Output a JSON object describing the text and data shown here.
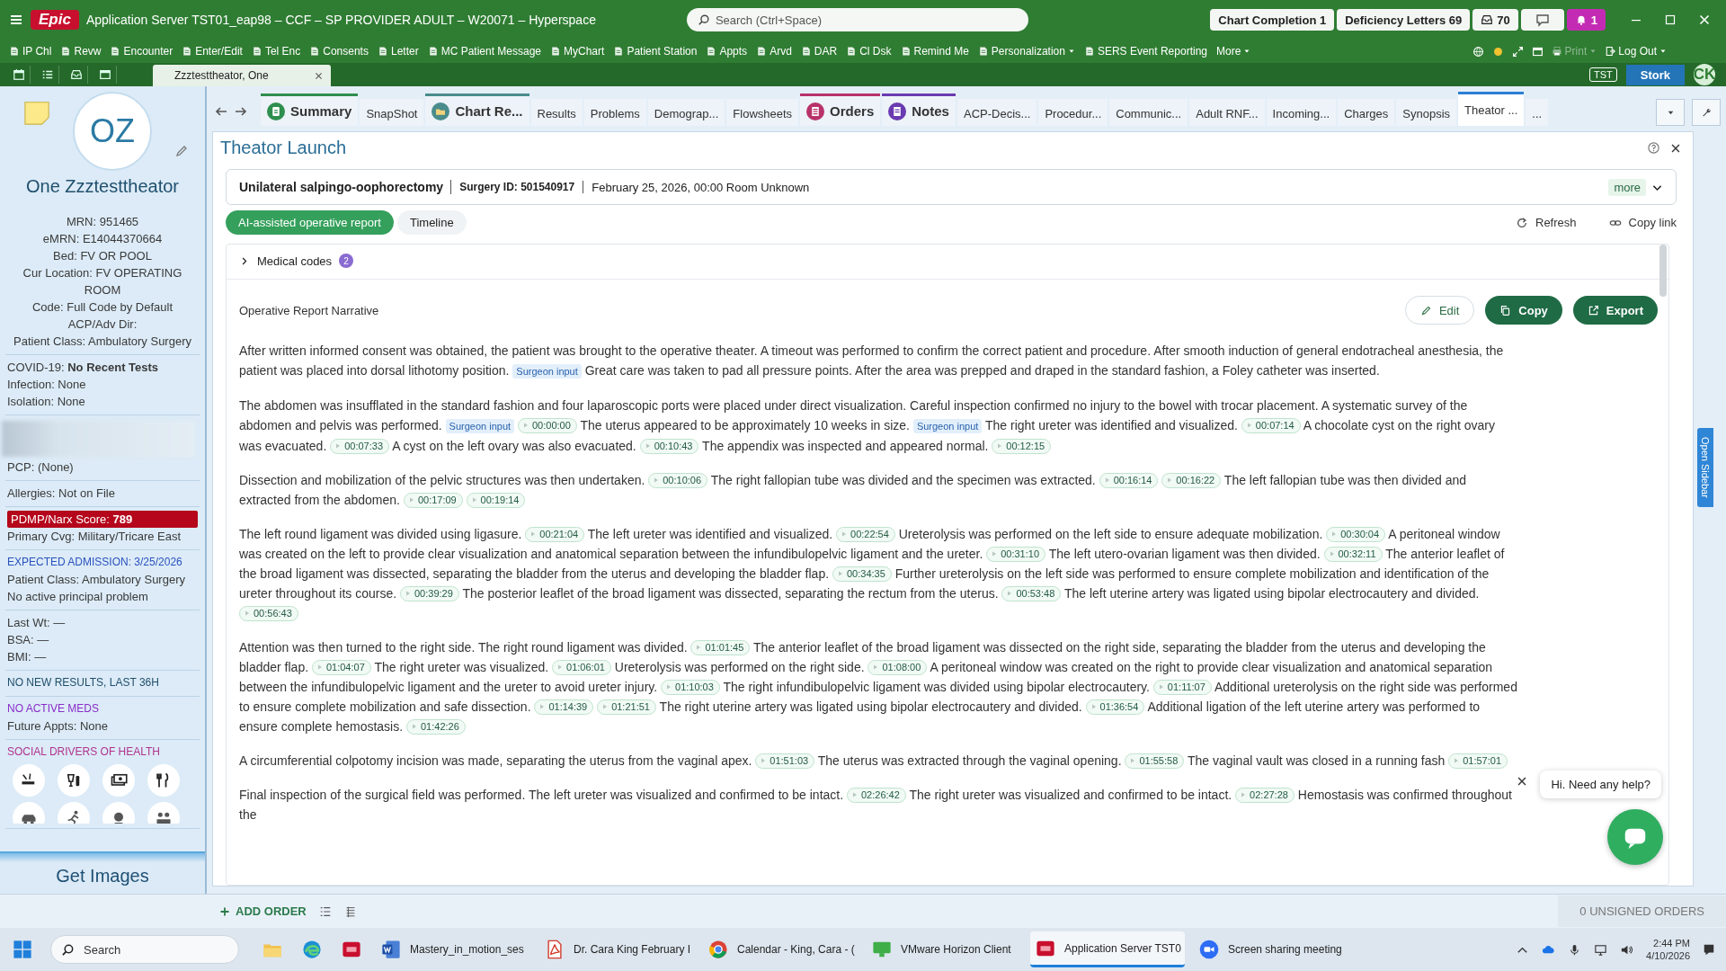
{
  "window": {
    "title": "Application Server TST01_eap98 – CCF – SP PROVIDER ADULT – W20071 – Hyperspace",
    "logo": "Epic"
  },
  "search": {
    "placeholder": "Search (Ctrl+Space)"
  },
  "header_buttons": [
    {
      "kind": "text",
      "label": "Chart Completion 1"
    },
    {
      "kind": "text",
      "label": "Deficiency Letters 69"
    },
    {
      "kind": "inbox",
      "label": "70"
    },
    {
      "kind": "chat"
    },
    {
      "kind": "bell",
      "label": "1"
    }
  ],
  "toolbar": [
    {
      "label": "IP Chl",
      "icon": true,
      "dropdown": false
    },
    {
      "label": "Revw",
      "icon": true,
      "dropdown": false
    },
    {
      "label": "Encounter",
      "icon": true,
      "dropdown": false
    },
    {
      "label": "Enter/Edit",
      "icon": true,
      "dropdown": false
    },
    {
      "label": "Tel Enc",
      "icon": true,
      "dropdown": false
    },
    {
      "label": "Consents",
      "icon": true,
      "dropdown": false
    },
    {
      "label": "Letter",
      "icon": true,
      "dropdown": false
    },
    {
      "label": "MC Patient Message",
      "icon": true,
      "dropdown": false
    },
    {
      "label": "MyChart",
      "icon": true,
      "dropdown": false
    },
    {
      "label": "Patient Station",
      "icon": true,
      "dropdown": false
    },
    {
      "label": "Appts",
      "icon": true,
      "dropdown": false
    },
    {
      "label": "Arvd",
      "icon": true,
      "dropdown": false
    },
    {
      "label": "DAR",
      "icon": true,
      "dropdown": false
    },
    {
      "label": "Cl Dsk",
      "icon": true,
      "dropdown": false
    },
    {
      "label": "Remind Me",
      "icon": true,
      "dropdown": false
    },
    {
      "label": "Personalization",
      "icon": true,
      "dropdown": true
    },
    {
      "label": "SERS Event Reporting",
      "icon": true,
      "dropdown": false
    },
    {
      "label": "More",
      "icon": false,
      "dropdown": true
    }
  ],
  "toolbar_right": [
    {
      "label": "Print",
      "disabled": true
    },
    {
      "label": "Log Out",
      "disabled": false
    }
  ],
  "patient_tab": {
    "label": "Zzztesttheator, One"
  },
  "environment": {
    "badge": "TST",
    "user": "Stork",
    "initials": "CK"
  },
  "sidebar": {
    "initials": "OZ",
    "name": "One Zzztesttheator",
    "sections": [
      {
        "lines": [
          {
            "kind": "center",
            "text": "MRN: 951465"
          },
          {
            "kind": "center",
            "text": "eMRN: E14044370664"
          },
          {
            "kind": "center",
            "text": "Bed: FV OR POOL"
          },
          {
            "kind": "center",
            "text": "Cur Location: FV OPERATING ROOM"
          },
          {
            "kind": "center",
            "text": "Code: Full Code by Default"
          },
          {
            "kind": "center",
            "text": "ACP/Adv Dir:"
          },
          {
            "kind": "center",
            "text": "Patient Class: Ambulatory Surgery"
          }
        ]
      },
      {
        "lines": [
          {
            "kind": "plain",
            "text": "COVID-19: **No Recent Tests**"
          },
          {
            "kind": "plain",
            "text": "Infection: None"
          },
          {
            "kind": "plain",
            "text": "Isolation: None"
          }
        ]
      },
      {
        "lines": [
          {
            "kind": "redacted"
          },
          {
            "kind": "plain",
            "text": "PCP: (None)"
          }
        ]
      },
      {
        "lines": [
          {
            "kind": "plain",
            "text": "Allergies: Not on File"
          }
        ]
      },
      {
        "lines": [
          {
            "kind": "alert",
            "text": "PDMP/Narx Score: **789**"
          },
          {
            "kind": "plain",
            "text": "Primary Cvg: Military/Tricare East"
          }
        ]
      },
      {
        "lines": [
          {
            "kind": "heading",
            "text": "EXPECTED ADMISSION: 3/25/2026",
            "color": "#2a52be"
          },
          {
            "kind": "plain",
            "text": "Patient Class: Ambulatory Surgery"
          },
          {
            "kind": "plain",
            "text": "No active principal problem"
          }
        ]
      },
      {
        "lines": [
          {
            "kind": "plain",
            "text": "Last Wt: —"
          },
          {
            "kind": "plain",
            "text": "BSA: —"
          },
          {
            "kind": "plain",
            "text": "BMI: —"
          }
        ]
      },
      {
        "lines": [
          {
            "kind": "heading",
            "text": "NO NEW RESULTS, LAST 36H",
            "color": "#1f4e6b"
          }
        ]
      },
      {
        "lines": [
          {
            "kind": "heading",
            "text": "NO ACTIVE MEDS",
            "color": "#8a2cc9"
          },
          {
            "kind": "plain",
            "text": "Future Appts: None"
          }
        ]
      },
      {
        "lines": [
          {
            "kind": "heading",
            "text": "SOCIAL DRIVERS OF HEALTH",
            "color": "#b0338f"
          },
          {
            "kind": "sdoh"
          }
        ]
      }
    ],
    "get_images": "Get Images"
  },
  "tabs": [
    {
      "label": "Summary",
      "kind": "summary",
      "selected": false
    },
    {
      "label": "SnapShot",
      "selected": false
    },
    {
      "label": "Chart Re...",
      "kind": "chart",
      "selected": false
    },
    {
      "label": "Results",
      "selected": false
    },
    {
      "label": "Problems",
      "selected": false
    },
    {
      "label": "Demograp...",
      "selected": false
    },
    {
      "label": "Flowsheets",
      "selected": false
    },
    {
      "label": "Orders",
      "kind": "orders",
      "selected": false
    },
    {
      "label": "Notes",
      "kind": "notes",
      "selected": false
    },
    {
      "label": "ACP-Decis...",
      "selected": false
    },
    {
      "label": "Procedur...",
      "selected": false
    },
    {
      "label": "Communic...",
      "selected": false
    },
    {
      "label": "Adult RNF...",
      "selected": false
    },
    {
      "label": "Incoming...",
      "selected": false
    },
    {
      "label": "Charges",
      "selected": false
    },
    {
      "label": "Synopsis",
      "selected": false
    },
    {
      "label": "Theator ...",
      "selected": true
    },
    {
      "label": "...",
      "selected": false
    }
  ],
  "panel": {
    "title": "Theator Launch",
    "surgery": {
      "procedure": "Unilateral salpingo-oophorectomy",
      "surgery_id": "Surgery ID: 501540917",
      "date": "February 25, 2026, 00:00 Room Unknown",
      "more": "more"
    },
    "view_tabs": [
      {
        "label": "AI-assisted operative report",
        "selected": true
      },
      {
        "label": "Timeline",
        "selected": false
      }
    ],
    "actions": [
      {
        "kind": "refresh",
        "label": "Refresh"
      },
      {
        "kind": "link",
        "label": "Copy link"
      }
    ],
    "medical_codes": {
      "label": "Medical codes",
      "count": "2",
      "expanded": false
    },
    "narrative": {
      "title": "Operative Report Narrative",
      "buttons": [
        {
          "kind": "edit",
          "label": "Edit"
        },
        {
          "kind": "copy",
          "label": "Copy"
        },
        {
          "kind": "export",
          "label": "Export"
        }
      ],
      "paragraphs": [
        [
          {
            "kind": "text",
            "text": "After written informed consent was obtained, the patient was brought to the operative theater. A timeout was performed to confirm the correct patient and procedure. After smooth induction of general endotracheal anesthesia, the patient was placed into dorsal lithotomy position."
          },
          {
            "kind": "tag",
            "text": "Surgeon input"
          },
          {
            "kind": "text",
            "text": "Great care was taken to pad all pressure points. After the area was prepped and draped in the standard fashion, a Foley catheter was inserted."
          }
        ],
        [
          {
            "kind": "text",
            "text": "The abdomen was insufflated in the standard fashion and four laparoscopic ports were placed under direct visualization. Careful inspection confirmed no injury to the bowel with trocar placement. A systematic survey of the abdomen and pelvis was performed."
          },
          {
            "kind": "tag",
            "text": "Surgeon input"
          },
          {
            "kind": "time",
            "text": "00:00:00"
          },
          {
            "kind": "text",
            "text": "The uterus appeared to be approximately 10 weeks in size."
          },
          {
            "kind": "tag",
            "text": "Surgeon input"
          },
          {
            "kind": "text",
            "text": "The right ureter was identified and visualized."
          },
          {
            "kind": "time",
            "text": "00:07:14"
          },
          {
            "kind": "text",
            "text": "A chocolate cyst on the right ovary was evacuated."
          },
          {
            "kind": "time",
            "text": "00:07:33"
          },
          {
            "kind": "text",
            "text": "A cyst on the left ovary was also evacuated."
          },
          {
            "kind": "time",
            "text": "00:10:43"
          },
          {
            "kind": "text",
            "text": "The appendix was inspected and appeared normal."
          },
          {
            "kind": "time",
            "text": "00:12:15"
          }
        ],
        [
          {
            "kind": "text",
            "text": "Dissection and mobilization of the pelvic structures was then undertaken."
          },
          {
            "kind": "time",
            "text": "00:10:06"
          },
          {
            "kind": "text",
            "text": "The right fallopian tube was divided and the specimen was extracted."
          },
          {
            "kind": "time",
            "text": "00:16:14"
          },
          {
            "kind": "time",
            "text": "00:16:22"
          },
          {
            "kind": "text",
            "text": "The left fallopian tube was then divided and extracted from the abdomen."
          },
          {
            "kind": "time",
            "text": "00:17:09"
          },
          {
            "kind": "time",
            "text": "00:19:14"
          }
        ],
        [
          {
            "kind": "text",
            "text": "The left round ligament was divided using ligasure."
          },
          {
            "kind": "time",
            "text": "00:21:04"
          },
          {
            "kind": "text",
            "text": "The left ureter was identified and visualized."
          },
          {
            "kind": "time",
            "text": "00:22:54"
          },
          {
            "kind": "text",
            "text": "Ureterolysis was performed on the left side to ensure adequate mobilization."
          },
          {
            "kind": "time",
            "text": "00:30:04"
          },
          {
            "kind": "text",
            "text": "A peritoneal window was created on the left to provide clear visualization and anatomical separation between the infundibulopelvic ligament and the ureter."
          },
          {
            "kind": "time",
            "text": "00:31:10"
          },
          {
            "kind": "text",
            "text": "The left utero-ovarian ligament was then divided."
          },
          {
            "kind": "time",
            "text": "00:32:11"
          },
          {
            "kind": "text",
            "text": "The anterior leaflet of the broad ligament was dissected, separating the bladder from the uterus and developing the bladder flap."
          },
          {
            "kind": "time",
            "text": "00:34:35"
          },
          {
            "kind": "text",
            "text": "Further ureterolysis on the left side was performed to ensure complete mobilization and identification of the ureter throughout its course."
          },
          {
            "kind": "time",
            "text": "00:39:29"
          },
          {
            "kind": "text",
            "text": "The posterior leaflet of the broad ligament was dissected, separating the rectum from the uterus."
          },
          {
            "kind": "time",
            "text": "00:53:48"
          },
          {
            "kind": "text",
            "text": "The left uterine artery was ligated using bipolar electrocautery and divided."
          },
          {
            "kind": "time",
            "text": "00:56:43"
          }
        ],
        [
          {
            "kind": "text",
            "text": "Attention was then turned to the right side. The right round ligament was divided."
          },
          {
            "kind": "time",
            "text": "01:01:45"
          },
          {
            "kind": "text",
            "text": "The anterior leaflet of the broad ligament was dissected on the right side, separating the bladder from the uterus and developing the bladder flap."
          },
          {
            "kind": "time",
            "text": "01:04:07"
          },
          {
            "kind": "text",
            "text": "The right ureter was visualized."
          },
          {
            "kind": "time",
            "text": "01:06:01"
          },
          {
            "kind": "text",
            "text": "Ureterolysis was performed on the right side."
          },
          {
            "kind": "time",
            "text": "01:08:00"
          },
          {
            "kind": "text",
            "text": "A peritoneal window was created on the right to provide clear visualization and anatomical separation between the infundibulopelvic ligament and the ureter to avoid ureter injury."
          },
          {
            "kind": "time",
            "text": "01:10:03"
          },
          {
            "kind": "text",
            "text": "The right infundibulopelvic ligament was divided using bipolar electrocautery."
          },
          {
            "kind": "time",
            "text": "01:11:07"
          },
          {
            "kind": "text",
            "text": "Additional ureterolysis on the right side was performed to ensure complete mobilization and safe dissection."
          },
          {
            "kind": "time",
            "text": "01:14:39"
          },
          {
            "kind": "time",
            "text": "01:21:51"
          },
          {
            "kind": "text",
            "text": "The right uterine artery was ligated using bipolar electrocautery and divided."
          },
          {
            "kind": "time",
            "text": "01:36:54"
          },
          {
            "kind": "text",
            "text": "Additional ligation of the left uterine artery was performed to ensure complete hemostasis."
          },
          {
            "kind": "time",
            "text": "01:42:26"
          }
        ],
        [
          {
            "kind": "text",
            "text": "A circumferential colpotomy incision was made, separating the uterus from the vaginal apex."
          },
          {
            "kind": "time",
            "text": "01:51:03"
          },
          {
            "kind": "text",
            "text": "The uterus was extracted through the vaginal opening."
          },
          {
            "kind": "time",
            "text": "01:55:58"
          },
          {
            "kind": "text",
            "text": "The vaginal vault was closed in a running fash"
          },
          {
            "kind": "time",
            "text": "01:57:01"
          }
        ],
        [
          {
            "kind": "text",
            "text": "Final inspection of the surgical field was performed. The left ureter was visualized and confirmed to be intact."
          },
          {
            "kind": "time",
            "text": "02:26:42"
          },
          {
            "kind": "text",
            "text": "The right ureter was visualized and confirmed to be intact."
          },
          {
            "kind": "time",
            "text": "02:27:28"
          },
          {
            "kind": "text",
            "text": "Hemostasis was confirmed throughout the"
          }
        ]
      ]
    },
    "chat": {
      "greeting": "Hi. Need any help?"
    },
    "side_tab": "Open Sidebar"
  },
  "bottom_bar": {
    "add_order": "ADD ORDER",
    "unsigned": "0 UNSIGNED ORDERS"
  },
  "taskbar": {
    "search": {
      "placeholder": "Search"
    },
    "apps": [
      {
        "kind": "folder",
        "selected": false
      },
      {
        "kind": "browser",
        "selected": false
      },
      {
        "kind": "epic",
        "selected": false
      },
      {
        "kind": "word",
        "label": "Mastery_in_motion_ses",
        "selected": false
      },
      {
        "kind": "pdf",
        "label": "Dr. Cara King February I",
        "selected": false
      },
      {
        "kind": "chrome",
        "label": "Calendar - King, Cara - (",
        "selected": false
      },
      {
        "kind": "vmware",
        "label": "VMware Horizon Client",
        "selected": false
      },
      {
        "kind": "epic",
        "label": "Application Server TST0",
        "selected": true
      },
      {
        "kind": "zoom",
        "label": "Screen sharing meeting",
        "selected": false
      }
    ],
    "time": "2:44 PM",
    "date": "4/10/2026"
  }
}
